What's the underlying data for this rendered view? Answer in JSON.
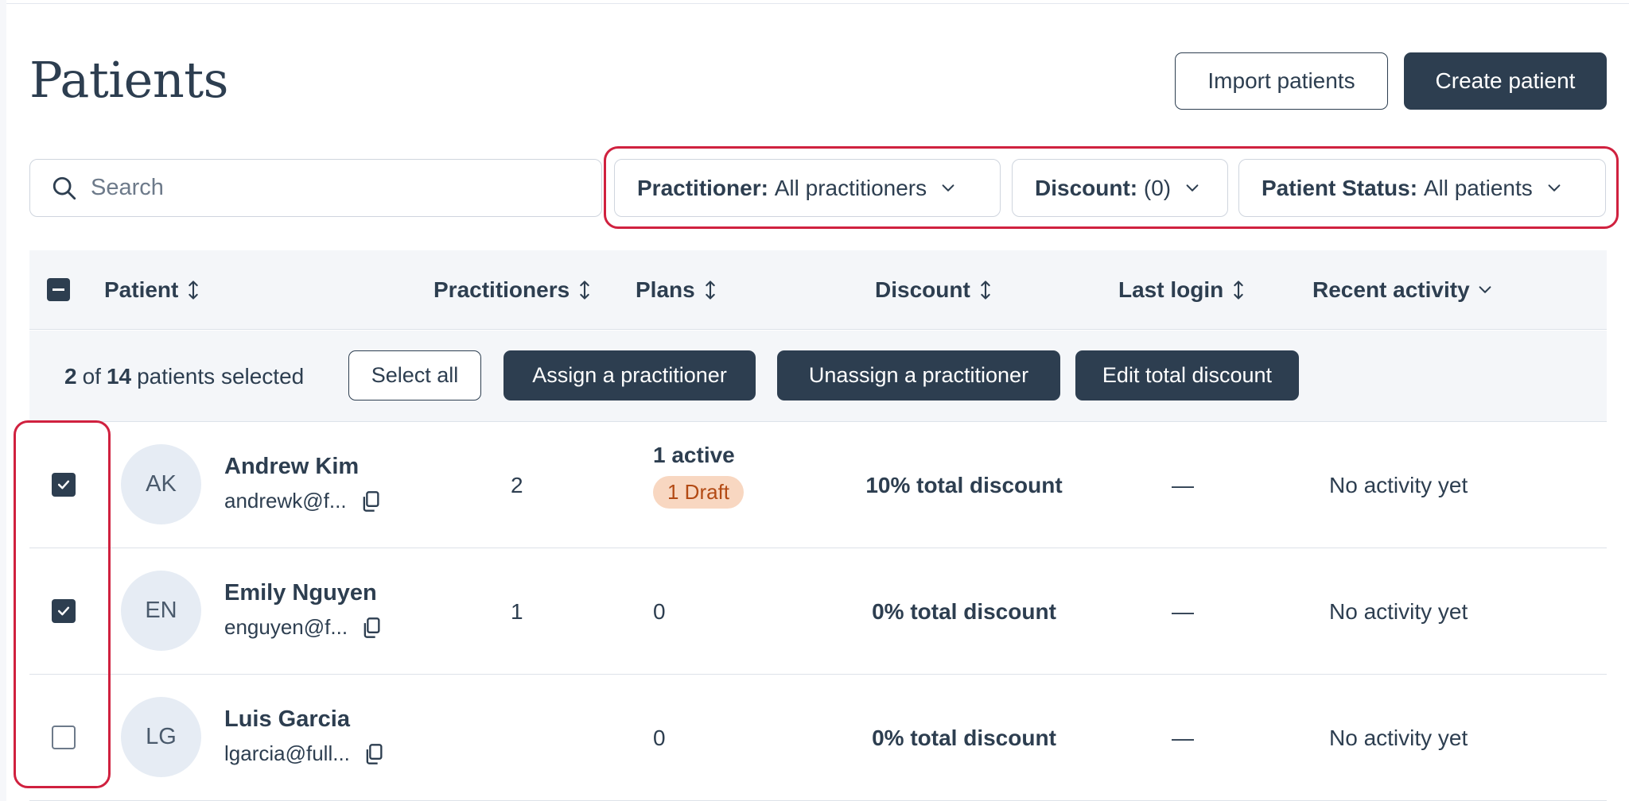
{
  "page": {
    "title": "Patients",
    "import_label": "Import patients",
    "create_label": "Create patient"
  },
  "search": {
    "placeholder": "Search",
    "value": ""
  },
  "filters": [
    {
      "label": "Practitioner:",
      "value": "All practitioners"
    },
    {
      "label": "Discount:",
      "value": "(0)"
    },
    {
      "label": "Patient Status:",
      "value": "All patients"
    }
  ],
  "table": {
    "columns": [
      "Patient",
      "Practitioners",
      "Plans",
      "Discount",
      "Last login",
      "Recent activity"
    ],
    "selection": {
      "selected": "2",
      "of": "of",
      "total": "14",
      "suffix": "patients selected",
      "select_all": "Select all",
      "assign": "Assign a practitioner",
      "unassign": "Unassign a practitioner",
      "edit_discount": "Edit total discount"
    },
    "rows": [
      {
        "checked": true,
        "initials": "AK",
        "name": "Andrew Kim",
        "email": "andrewk@f...",
        "practitioners": "2",
        "plans_active": "1 active",
        "plans_draft": "1 Draft",
        "plans": "",
        "discount": "10% total discount",
        "last_login": "—",
        "recent_activity": "No activity yet"
      },
      {
        "checked": true,
        "initials": "EN",
        "name": "Emily Nguyen",
        "email": "enguyen@f...",
        "practitioners": "1",
        "plans_active": "",
        "plans_draft": "",
        "plans": "0",
        "discount": "0% total discount",
        "last_login": "—",
        "recent_activity": "No activity yet"
      },
      {
        "checked": false,
        "initials": "LG",
        "name": "Luis Garcia",
        "email": "lgarcia@full...",
        "practitioners": "",
        "plans_active": "",
        "plans_draft": "",
        "plans": "0",
        "discount": "0% total discount",
        "last_login": "—",
        "recent_activity": "No activity yet"
      }
    ]
  },
  "colors": {
    "primary": "#2d3e50",
    "highlight": "#d0213f",
    "header_bg": "#f4f6f9",
    "draft_bg": "#f8d7c1",
    "draft_text": "#b34a14",
    "avatar_bg": "#e6ecf4"
  }
}
